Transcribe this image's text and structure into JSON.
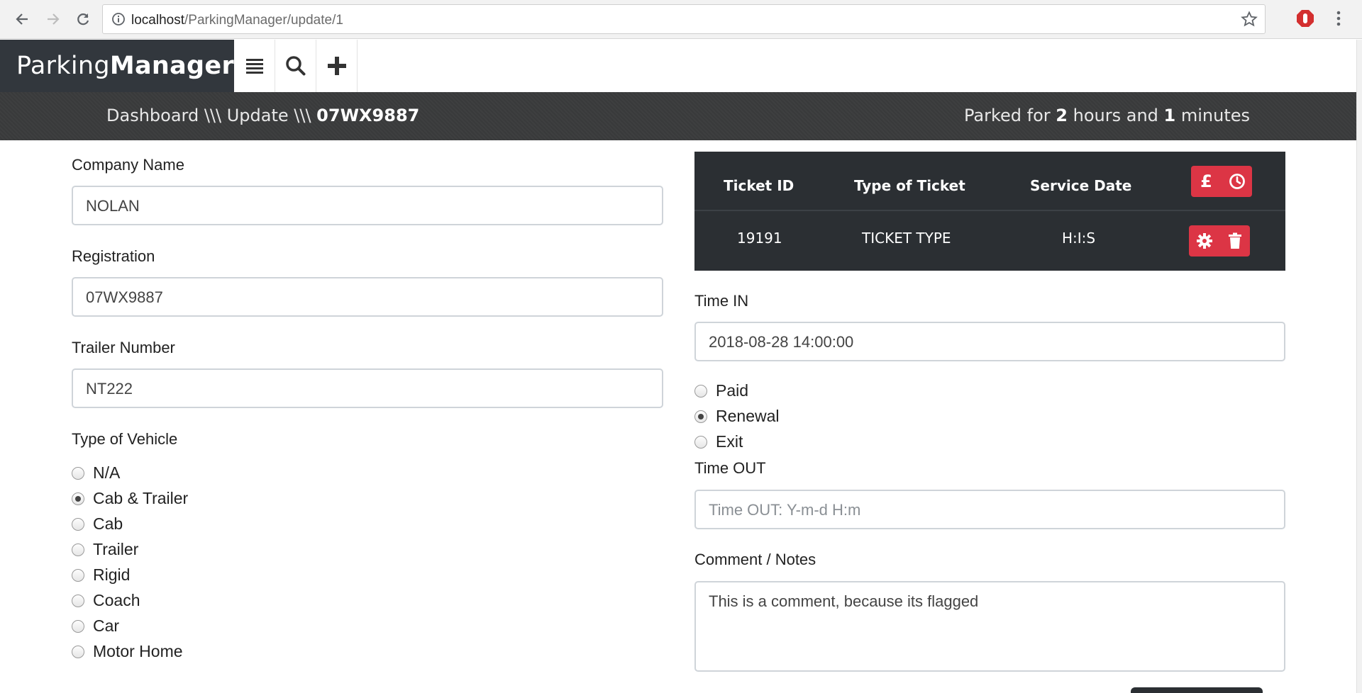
{
  "browser": {
    "url_host": "localhost",
    "url_path": "/ParkingManager/update/1"
  },
  "app": {
    "brand_light": "Parking",
    "brand_bold": "Manager"
  },
  "breadcrumb": {
    "dashboard": "Dashboard",
    "sep1": " \\\\\\ ",
    "update": "Update",
    "sep2": " \\\\\\ ",
    "registration": "07WX9887"
  },
  "parked": {
    "prefix": "Parked for ",
    "hours": "2",
    "middle": " hours and ",
    "minutes": "1",
    "suffix": " minutes"
  },
  "form": {
    "company_label": "Company Name",
    "company_value": "NOLAN",
    "registration_label": "Registration",
    "registration_value": "07WX9887",
    "trailer_label": "Trailer Number",
    "trailer_value": "NT222",
    "vehicle_label": "Type of Vehicle",
    "vehicle_options": [
      "N/A",
      "Cab & Trailer",
      "Cab",
      "Trailer",
      "Rigid",
      "Coach",
      "Car",
      "Motor Home"
    ],
    "vehicle_selected": "Cab & Trailer",
    "time_in_label": "Time IN",
    "time_in_value": "2018-08-28 14:00:00",
    "status_options": [
      "Paid",
      "Renewal",
      "Exit"
    ],
    "status_selected": "Renewal",
    "time_out_label": "Time OUT",
    "time_out_placeholder": "Time OUT: Y-m-d H:m",
    "comment_label": "Comment / Notes",
    "comment_value": "This is a comment, because its flagged"
  },
  "tickets": {
    "headers": [
      "Ticket ID",
      "Type of Ticket",
      "Service Date"
    ],
    "rows": [
      {
        "id": "19191",
        "type": "TICKET TYPE",
        "date": "H:I:S"
      }
    ]
  },
  "icons": {
    "pound": "pound-icon",
    "clock": "clock-icon",
    "gear": "gear-icon",
    "trash": "trash-icon",
    "list": "list-icon",
    "search": "search-icon",
    "plus": "plus-icon"
  },
  "colors": {
    "brand_bg": "#32373d",
    "danger": "#dc3545",
    "table_bg": "#2b2f33"
  }
}
